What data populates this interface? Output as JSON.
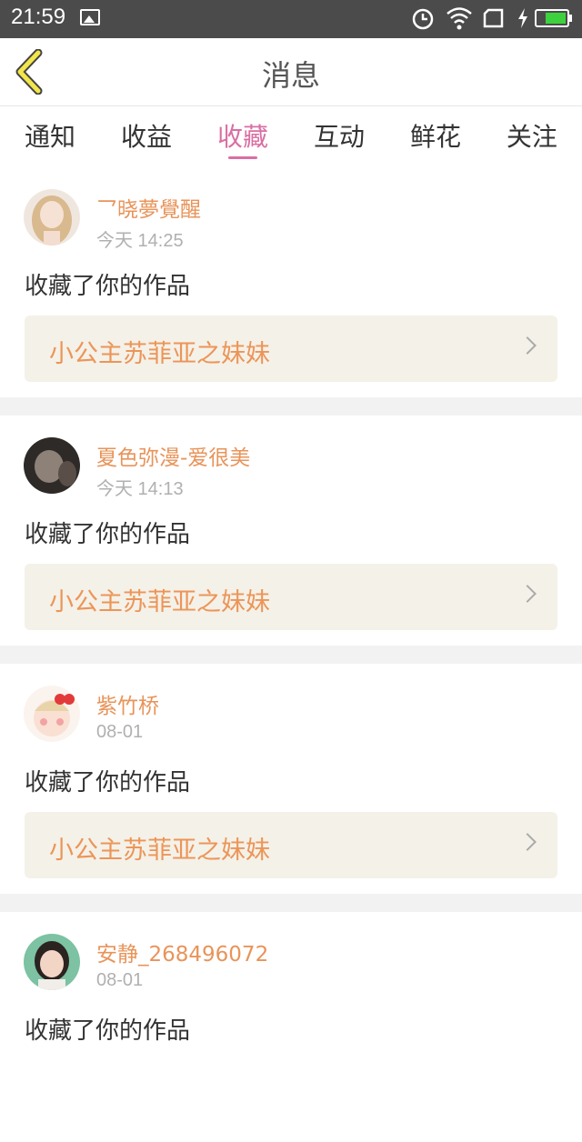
{
  "status_bar": {
    "time": "21:59"
  },
  "header": {
    "title": "消息"
  },
  "tabs": [
    {
      "label": "通知"
    },
    {
      "label": "收益"
    },
    {
      "label": "收藏",
      "active": true
    },
    {
      "label": "互动"
    },
    {
      "label": "鲜花"
    },
    {
      "label": "关注"
    }
  ],
  "colors": {
    "accent": "#d96fa3",
    "username": "#e8945a",
    "work_title": "#ec9558",
    "work_bg": "#f4f1e8"
  },
  "items": [
    {
      "username": "乛晓夢覺醒",
      "time": "今天 14:25",
      "action": "收藏了你的作品",
      "work": "小公主苏菲亚之妹妹"
    },
    {
      "username": "夏色弥漫-爱很美",
      "time": "今天 14:13",
      "action": "收藏了你的作品",
      "work": "小公主苏菲亚之妹妹"
    },
    {
      "username": "紫竹桥",
      "time": "08-01",
      "action": "收藏了你的作品",
      "work": "小公主苏菲亚之妹妹"
    },
    {
      "username": "安静_268496072",
      "time": "08-01",
      "action": "收藏了你的作品",
      "work": ""
    }
  ]
}
